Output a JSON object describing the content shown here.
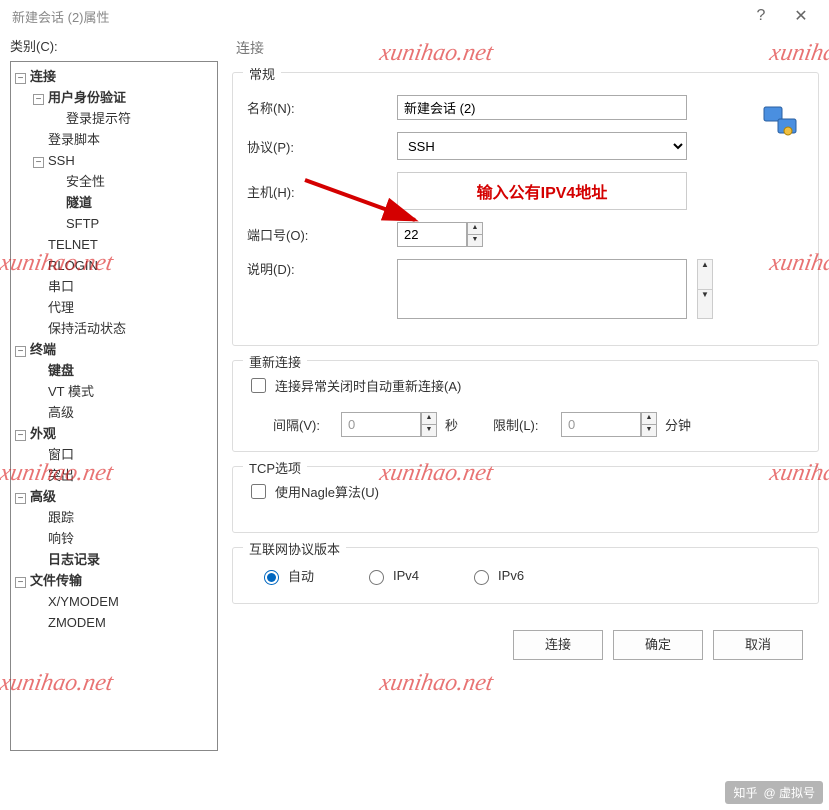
{
  "window": {
    "title": "新建会话 (2)属性",
    "help": "?",
    "close": "✕"
  },
  "category_label": "类别(C):",
  "tree": {
    "connection": "连接",
    "user_auth": "用户身份验证",
    "login_prompt": "登录提示符",
    "login_script": "登录脚本",
    "ssh": "SSH",
    "security": "安全性",
    "tunnel": "隧道",
    "sftp": "SFTP",
    "telnet": "TELNET",
    "rlogin": "RLOGIN",
    "serial": "串口",
    "proxy": "代理",
    "keepalive": "保持活动状态",
    "terminal": "终端",
    "keyboard": "键盘",
    "vtmode": "VT 模式",
    "advanced_term": "高级",
    "appearance": "外观",
    "window": "窗口",
    "highlight": "突出",
    "advanced": "高级",
    "trace": "跟踪",
    "bell": "响铃",
    "logging": "日志记录",
    "filetransfer": "文件传输",
    "xymodem": "X/YMODEM",
    "zmodem": "ZMODEM"
  },
  "panel_title": "连接",
  "general": {
    "title": "常规",
    "name_label": "名称(N):",
    "name_value": "新建会话 (2)",
    "proto_label": "协议(P):",
    "proto_value": "SSH",
    "host_label": "主机(H):",
    "host_placeholder": "输入公有IPV4地址",
    "port_label": "端口号(O):",
    "port_value": "22",
    "desc_label": "说明(D):"
  },
  "reconnect": {
    "title": "重新连接",
    "auto_label": "连接异常关闭时自动重新连接(A)",
    "interval_label": "间隔(V):",
    "interval_value": "0",
    "interval_unit": "秒",
    "limit_label": "限制(L):",
    "limit_value": "0",
    "limit_unit": "分钟"
  },
  "tcp": {
    "title": "TCP选项",
    "nagle_label": "使用Nagle算法(U)"
  },
  "ipver": {
    "title": "互联网协议版本",
    "auto": "自动",
    "ipv4": "IPv4",
    "ipv6": "IPv6"
  },
  "buttons": {
    "connect": "连接",
    "ok": "确定",
    "cancel": "取消"
  },
  "watermark": "xunihao.net",
  "zhihu": {
    "brand": "知乎",
    "author": "@ 虚拟号"
  }
}
